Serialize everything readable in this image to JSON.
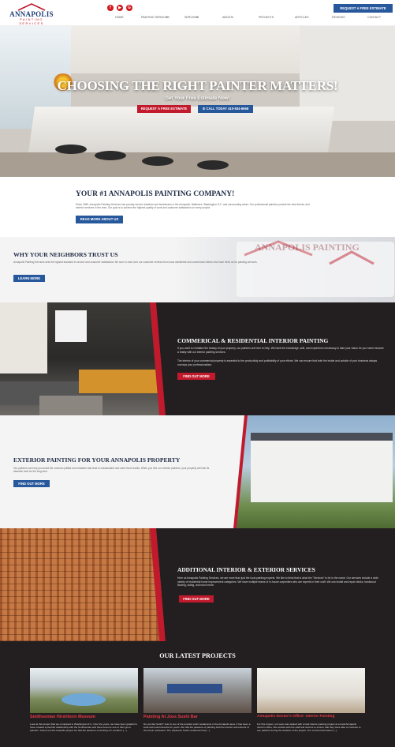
{
  "header": {
    "logo_text": "ANNAPOLIS",
    "logo_sub": "PAINTING SERVICES",
    "social_icons": [
      "facebook-icon",
      "youtube-icon",
      "google-icon"
    ],
    "nav": [
      "HOME",
      "PAINTING SERVICES",
      "SERVICES",
      "ABOUT",
      "PROJECTS",
      "ARTICLES",
      "REVIEWS",
      "CONTACT"
    ],
    "cta": "REQUEST A FREE ESTIMATE"
  },
  "hero": {
    "title": "CHOOSING THE RIGHT PAINTER MATTERS!",
    "subtitle": "Get Your Free Estimate Now!",
    "btn_estimate": "REQUEST A FREE ESTIMATE",
    "btn_call": "CALL TODAY 410-934-6568"
  },
  "intro": {
    "title": "YOUR #1 ANNAPOLIS PAINTING COMPANY!",
    "text": "Since 1985, Annapolis Painting Services has proudly served residents and businesses in the Annapolis, Baltimore, Washington D.C. and surrounding areas. Our professional painters provide the best interior and exterior services in the area. Our goal is to achieve the highest quality of work and customer satisfaction on every project.",
    "button": "READ MORE ABOUT US"
  },
  "trust": {
    "title": "WHY YOUR NEIGHBORS TRUST US",
    "text": "Annapolis Painting Services sets the highest standard in service and customer satisfaction. Be sure to read over our customer reviews from local residential and commercial clients who have hired us for painting services.",
    "button": "LEARN MORE",
    "truck_logo": "ANNAPOLIS PAINTING"
  },
  "interior": {
    "title": "COMMERICAL & RESIDENTIAL INTERIOR PAINTING",
    "text1": "If you want to revitalize the beauty of your property, our painters are here to help. We have the knowledge, skill, and experience necessary to take your vision for you home become a reality with our interior painting services.",
    "text2": "The interior of your commercial property is essential to the productivity and profitability of your efforts. We can ensure that both the inside and outside of your business always conveys your professionalism.",
    "button": "FIND OUT MORE"
  },
  "exterior": {
    "title": "EXTERIOR PAINTING FOR YOUR ANNAPOLIS PROPERTY",
    "text": "Our painters can help you avoid the common pitfalls and mistakes that lead to substandard and short lived results. When you hire our exterior painters, your property will look its absolute best for the long term.",
    "button": "FIND OUT MORE"
  },
  "additional": {
    "title": "ADDITIONAL INTERIOR & EXTERIOR SERVICES",
    "text": "Here at Annapolis Painting Services, we are more than just the local painting experts. We like to think that is what the \"Services\" is for in the name. Our services include a wide variety of residential home improvement categories. We have multiple teams of in-house carpenters who are experts in their craft. We can install and repair decks, hardwood flooring, siding, and much more.",
    "button": "FIND OUT MORE"
  },
  "projects": {
    "title": "OUR LATEST PROJECTS",
    "items": [
      {
        "title": "Smithsonian Hirshhorn Museum",
        "text": "Look at this project that we completed in Washington D.C. Over the years, we have been grateful to have created a plentiful relationship with the Smithsonian and have become one of their go-to painters. Check out this beautiful project we had the pleasure of working on! Location: [...]"
      },
      {
        "title": "Painting At Joss Sushi Bar",
        "text": "Do you like Sushi? Joss is one of the popular sushi restaurants in the Annapolis area. It has been a local and tourist favorite for years. We had the pleasure of painting both the interior and exterior of the iconic restaurant. The Japanese Sushi restaurant had [...]"
      },
      {
        "title": "Annapolis Doctor's Office: Interior Painting",
        "text": "For this project, our team was tasked with a total interior painting project at a local Annapolis doctor's office. We worked with the staff and doctors to ensure that they were able to continue to see patients during the duration of the project. Our commercial interior [...]"
      }
    ]
  },
  "colors": {
    "brand_blue": "#27589c",
    "brand_red": "#c21a2d",
    "dark_bg": "#231f20",
    "project_title": "#e63946"
  }
}
